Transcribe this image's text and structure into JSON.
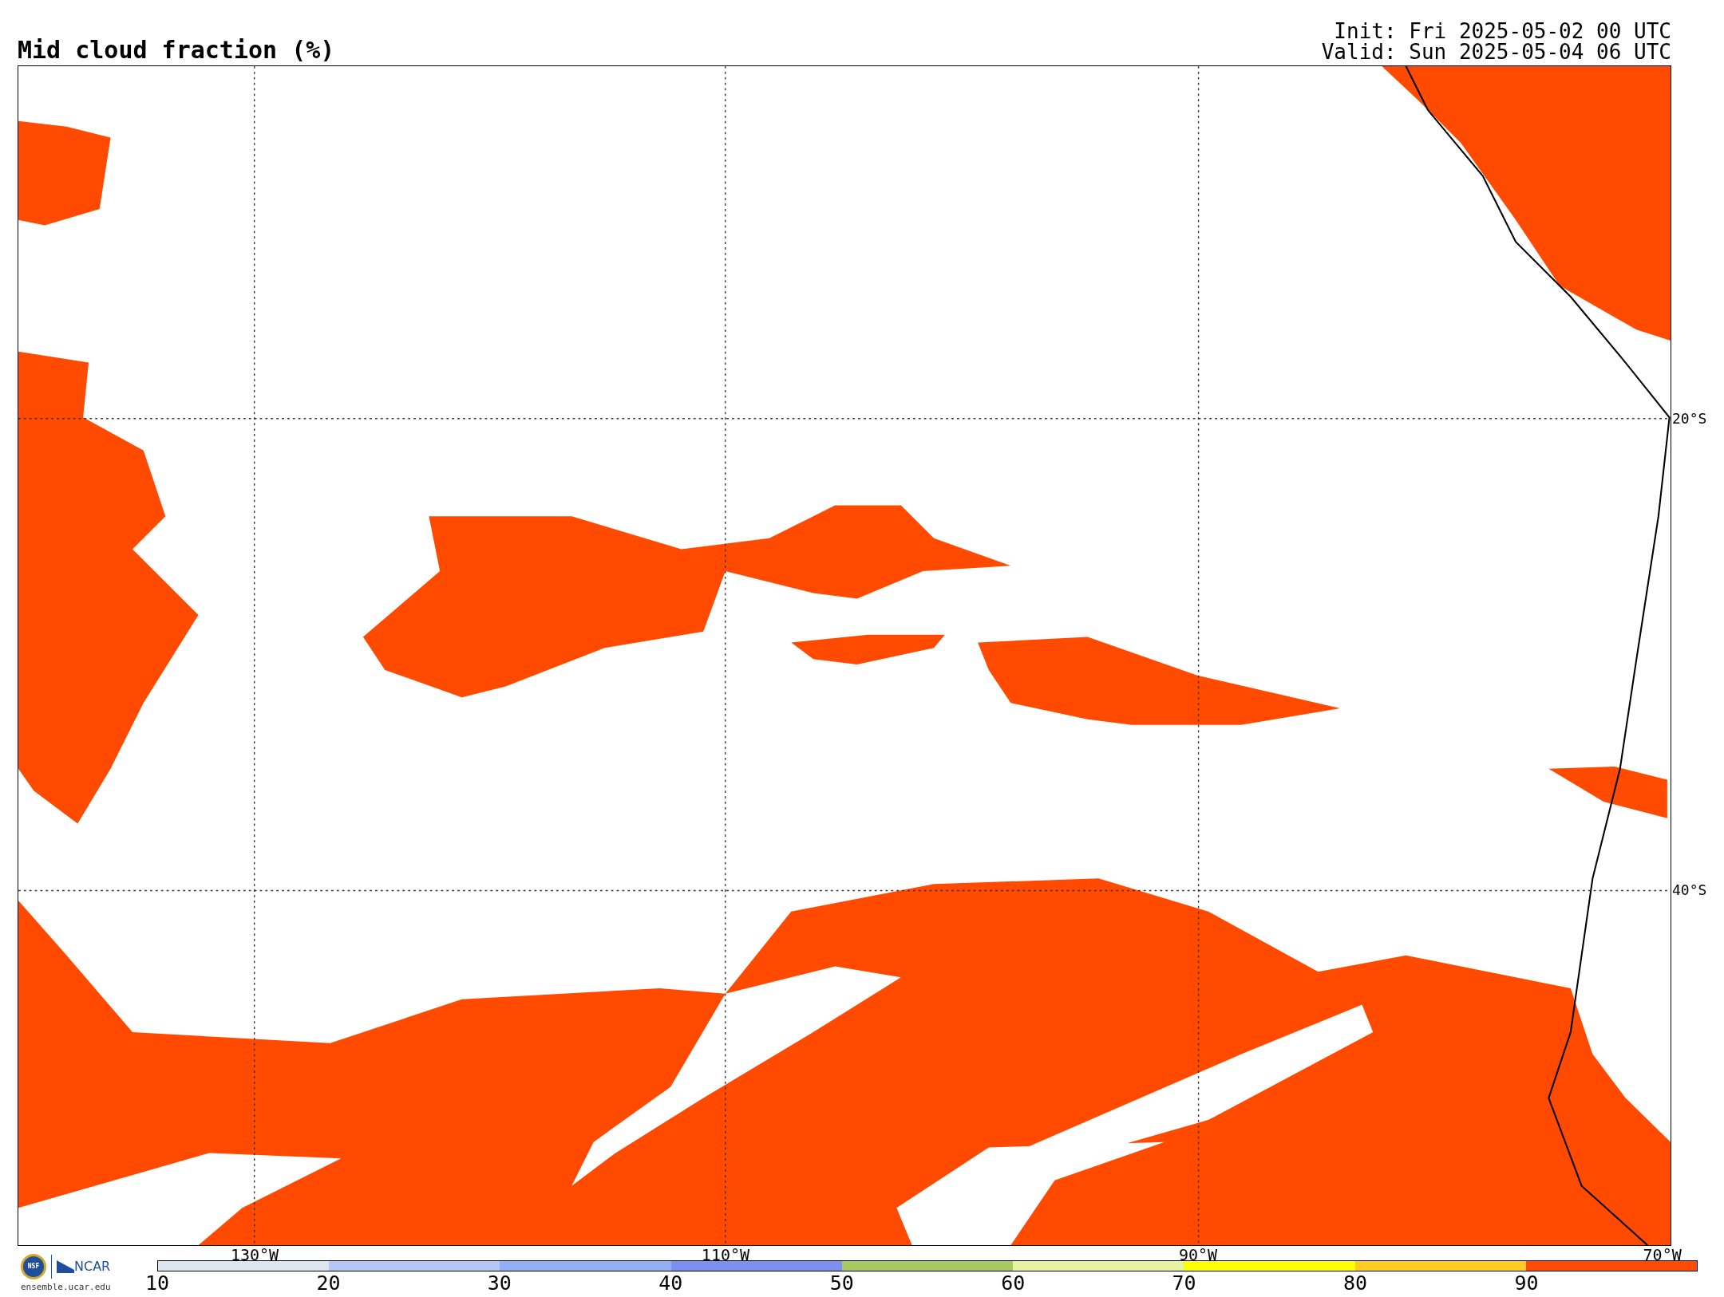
{
  "title": "Mid cloud fraction (%)",
  "init": "Init: Fri 2025-05-02 00 UTC",
  "valid": "Valid: Sun 2025-05-04 06 UTC",
  "map": {
    "lat_labels": [
      "20°S",
      "40°S"
    ],
    "lon_labels": [
      "130°W",
      "110°W",
      "90°W",
      "70°W"
    ]
  },
  "logo": {
    "nsf": "NSF",
    "ncar": "NCAR",
    "url": "ensemble.ucar.edu"
  },
  "colorbar": {
    "bins": [
      {
        "label": "10",
        "color": "#dde6ef"
      },
      {
        "label": "20",
        "color": "#b5c8f5"
      },
      {
        "label": "30",
        "color": "#8fb0f5"
      },
      {
        "label": "40",
        "color": "#7b90f0"
      },
      {
        "label": "50",
        "color": "#a7c95f"
      },
      {
        "label": "60",
        "color": "#e8f3a2"
      },
      {
        "label": "70",
        "color": "#ffff00"
      },
      {
        "label": "80",
        "color": "#ffcc22"
      },
      {
        "label": "90",
        "color": "#ff4a00"
      }
    ]
  }
}
